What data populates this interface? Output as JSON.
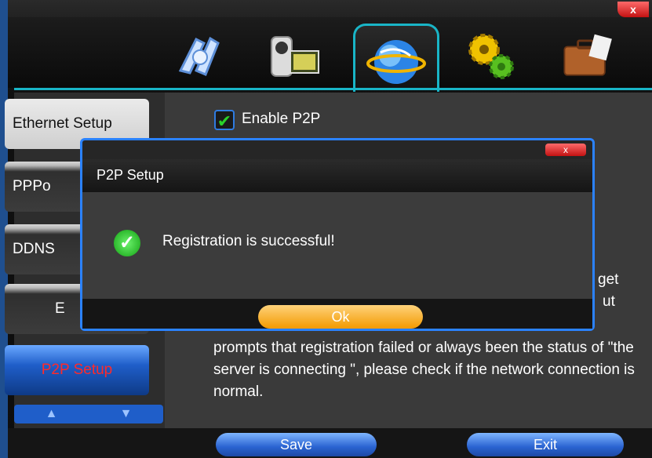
{
  "window": {
    "close_label": "x"
  },
  "tabs": [
    {
      "icon": "camera-film-icon"
    },
    {
      "icon": "camcorder-icon"
    },
    {
      "icon": "globe-network-icon",
      "active": true
    },
    {
      "icon": "gears-icon"
    },
    {
      "icon": "briefcase-icon"
    }
  ],
  "sidebar": {
    "items": [
      {
        "label": "Ethernet Setup"
      },
      {
        "label": "PPPo"
      },
      {
        "label": "DDNS"
      },
      {
        "label": "E"
      },
      {
        "label": "P2P Setup",
        "active": true
      }
    ],
    "arrow_up": "▲",
    "arrow_down": "▼"
  },
  "main": {
    "enable_p2p_label": "Enable P2P",
    "enable_p2p_checked": true,
    "partial_text_1": "get",
    "partial_text_2": "ut",
    "info_text": "prompts that registration failed or always been the status of \"the server is connecting \", please check if the network connection is normal."
  },
  "footer": {
    "save_label": "Save",
    "exit_label": "Exit"
  },
  "dialog": {
    "title": "P2P Setup",
    "close_label": "x",
    "message": "Registration is successful!",
    "ok_label": "Ok"
  },
  "colors": {
    "accent_cyan": "#19b5c7",
    "accent_blue": "#2b82ff",
    "ok_orange": "#f29a00",
    "success_green": "#2ad12a"
  }
}
